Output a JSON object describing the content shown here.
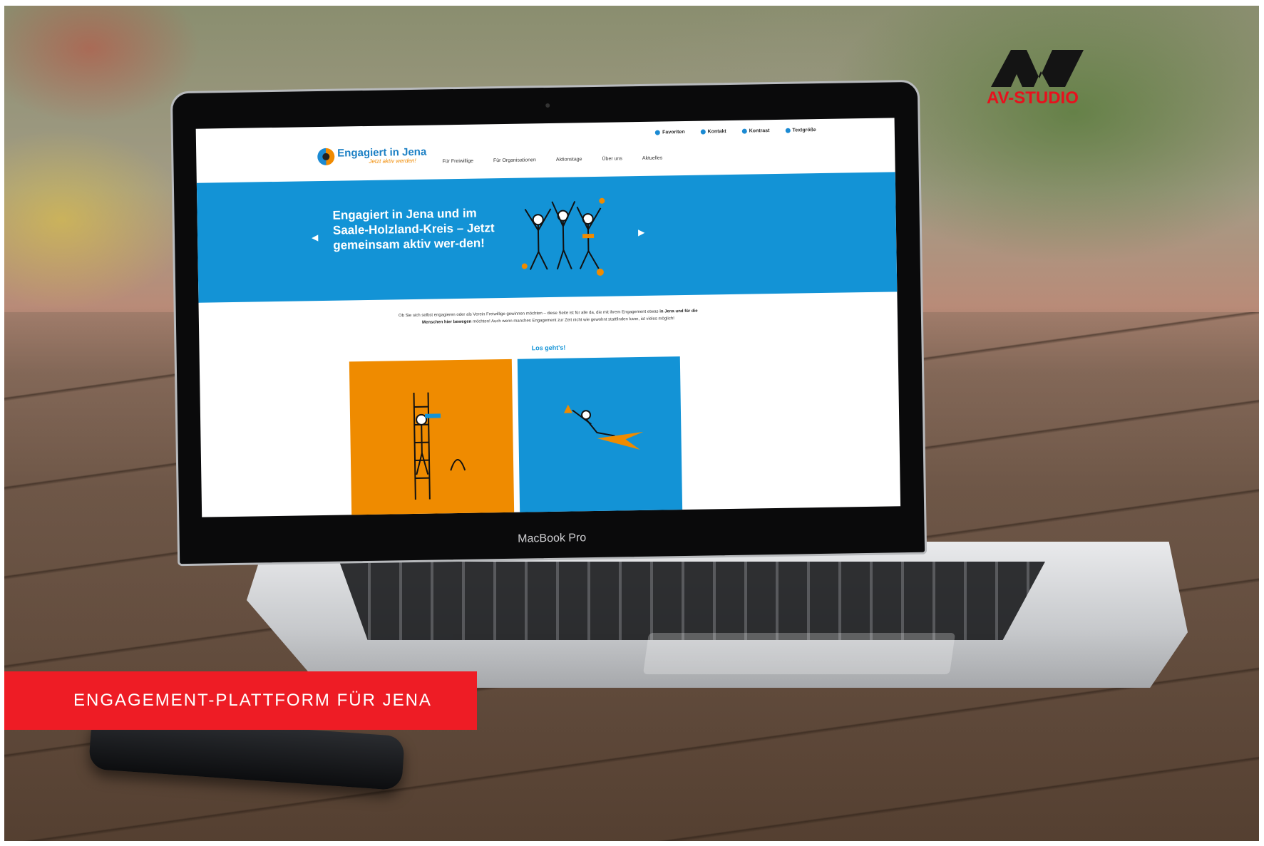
{
  "brand": {
    "studio_name": "AV-STUDIO",
    "accent_color": "#ee1c25"
  },
  "banner": {
    "text": "ENGAGEMENT-PLATTFORM FÜR JENA"
  },
  "laptop": {
    "model_label": "MacBook Pro"
  },
  "website": {
    "topbar": [
      "Favoriten",
      "Kontakt",
      "Kontrast",
      "Textgröße"
    ],
    "logo": {
      "title": "Engagiert in Jena",
      "tagline": "Jetzt aktiv werden!"
    },
    "nav": [
      "Für Freiwillige",
      "Für Organisationen",
      "Aktionstage",
      "Über uns",
      "Aktuelles"
    ],
    "hero": {
      "headline": "Engagiert in Jena und im Saale-Holzland-Kreis – Jetzt gemeinsam aktiv wer-den!",
      "prev_symbol": "◀",
      "next_symbol": "▶"
    },
    "intro": {
      "part1": "Ob Sie sich selbst engagieren oder als Verein Freiwillige gewinnen möchten – diese Seite ist für alle da, die mit ihrem Engagement etwas ",
      "bold1": "in Jena und für die Menschen hier bewegen",
      "part2": " möchten! Auch wenn manches Engagement zur Zeit nicht wie gewohnt stattfinden kann, ist vieles möglich!"
    },
    "cta": "Los geht's!",
    "colors": {
      "primary": "#1393d6",
      "secondary": "#ef8b00"
    }
  }
}
